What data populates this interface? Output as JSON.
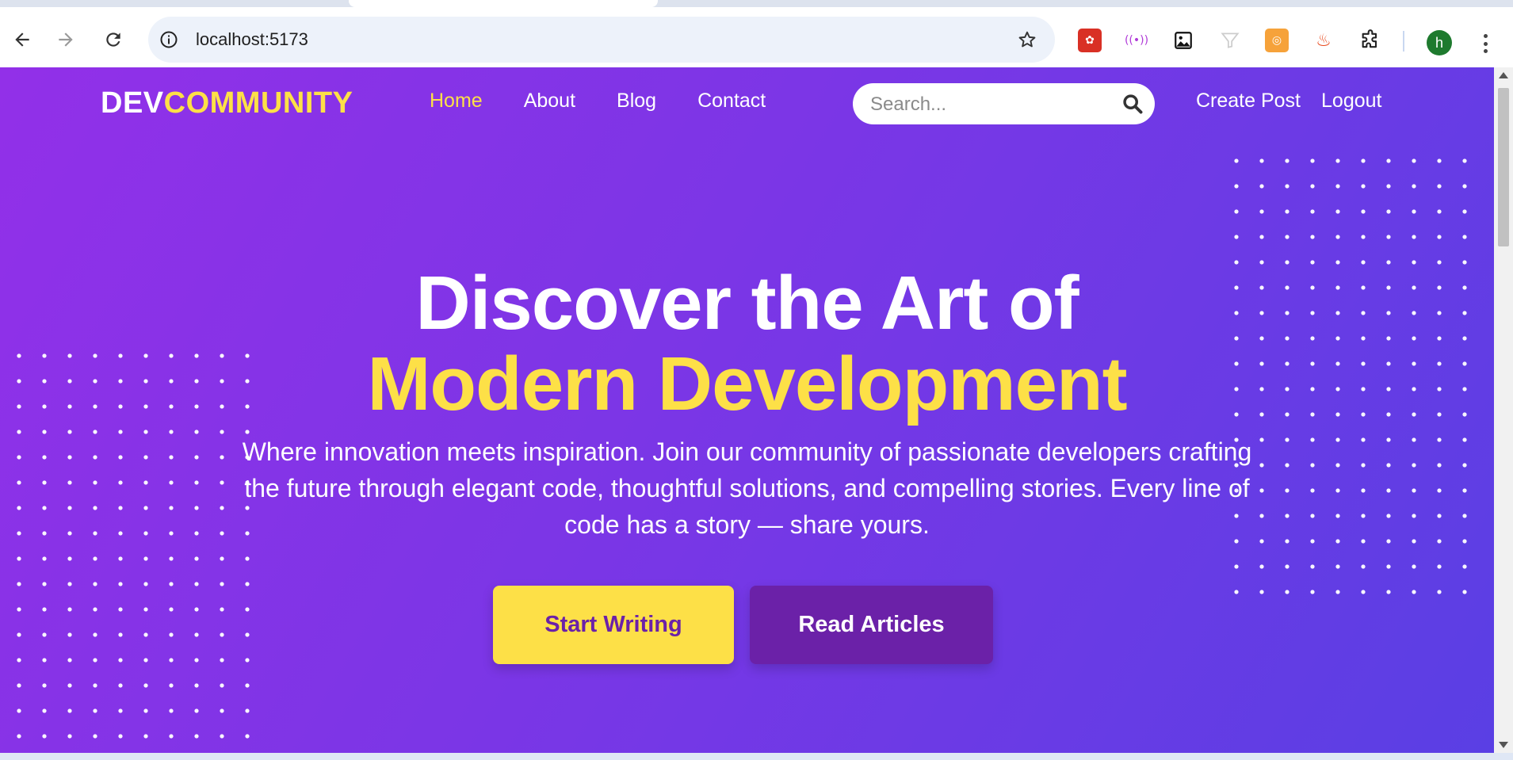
{
  "browser": {
    "url": "localhost:5173",
    "avatar_letter": "h",
    "extensions": [
      "paw-extension-icon",
      "broadcast-extension-icon",
      "image-extension-icon",
      "filter-extension-icon",
      "settings-extension-icon",
      "fire-extension-icon",
      "puzzle-extensions-icon"
    ]
  },
  "site": {
    "brand_part1": "DEV",
    "brand_part2": "COMMUNITY",
    "nav": [
      {
        "label": "Home",
        "active": true
      },
      {
        "label": "About",
        "active": false
      },
      {
        "label": "Blog",
        "active": false
      },
      {
        "label": "Contact",
        "active": false
      }
    ],
    "search_placeholder": "Search...",
    "actions": [
      "Create Post",
      "Logout"
    ]
  },
  "hero": {
    "title_line1": "Discover the Art of",
    "title_line2": "Modern Development",
    "subtitle": "Where innovation meets inspiration. Join our community of passionate developers crafting the future through elegant code, thoughtful solutions, and compelling stories. Every line of code has a story — share yours.",
    "primary_cta": "Start Writing",
    "secondary_cta": "Read Articles"
  },
  "colors": {
    "accent_yellow": "#fde047",
    "deep_purple": "#6b21a8",
    "gradient_start": "#9230e8",
    "gradient_end": "#5a3fe4"
  }
}
